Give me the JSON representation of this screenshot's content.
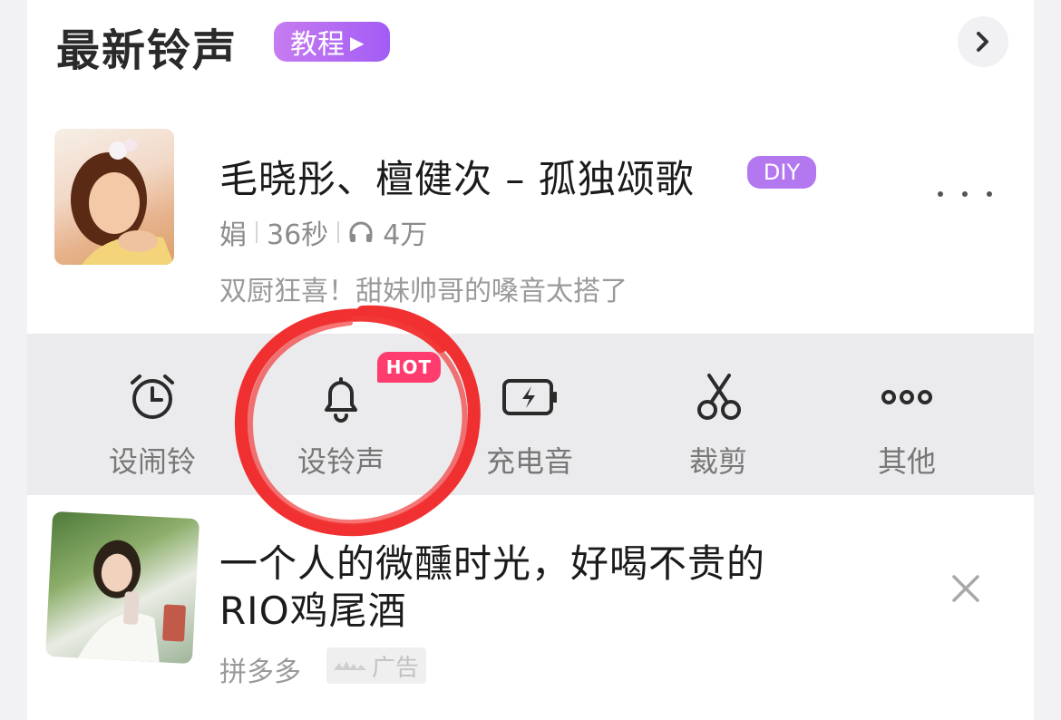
{
  "header": {
    "title": "最新铃声",
    "tutorial_label": "教程"
  },
  "song": {
    "title": "毛晓彤、檀健次 – 孤独颂歌",
    "badge": "DIY",
    "author": "娟",
    "duration": "36秒",
    "plays": "4万",
    "description": "双厨狂喜！甜妹帅哥的嗓音太搭了"
  },
  "actions": [
    {
      "label": "设闹铃",
      "icon": "alarm-clock-icon"
    },
    {
      "label": "设铃声",
      "icon": "bell-icon",
      "badge": "HOT"
    },
    {
      "label": "充电音",
      "icon": "battery-charging-icon"
    },
    {
      "label": "裁剪",
      "icon": "scissors-icon"
    },
    {
      "label": "其他",
      "icon": "more-dots-icon"
    }
  ],
  "ad": {
    "title_line1": "一个人的微醺时光，好喝不贵的",
    "title_line2": "RIO鸡尾酒",
    "source": "拼多多",
    "ad_label": "广告"
  },
  "colors": {
    "accent_purple": "#b377f0",
    "hot_pink": "#ff3c6e",
    "annotation_red": "#f02020"
  }
}
